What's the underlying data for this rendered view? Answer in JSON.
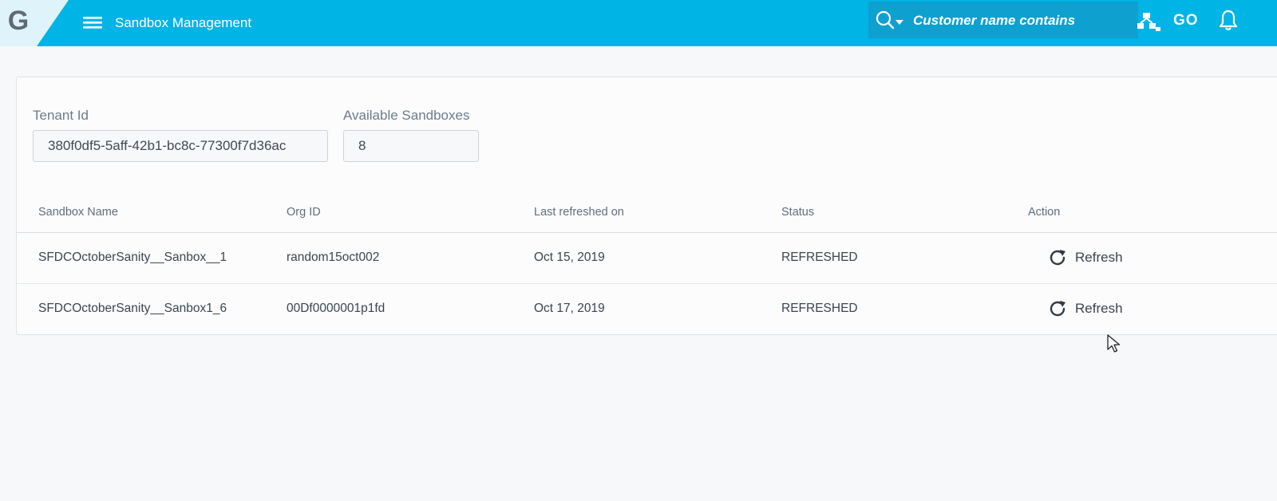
{
  "header": {
    "logo_letter": "G",
    "app_title": "Sandbox Management",
    "search_placeholder": "Customer name contains",
    "go_label": "GO"
  },
  "tenant": {
    "tenant_id_label": "Tenant Id",
    "tenant_id_value": "380f0df5-5aff-42b1-bc8c-77300f7d36ac",
    "available_label": "Available Sandboxes",
    "available_value": "8"
  },
  "table": {
    "columns": [
      "Sandbox Name",
      "Org ID",
      "Last refreshed on",
      "Status",
      "Action"
    ],
    "rows": [
      {
        "sandbox_name": "SFDCOctoberSanity__Sanbox__1",
        "org_id": "random15oct002",
        "last_refreshed": "Oct 15, 2019",
        "status": "REFRESHED",
        "action": "Refresh"
      },
      {
        "sandbox_name": "SFDCOctoberSanity__Sanbox1_6",
        "org_id": "00Df0000001p1fd",
        "last_refreshed": "Oct 17, 2019",
        "status": "REFRESHED",
        "action": "Refresh"
      }
    ]
  },
  "icons": {
    "menu": "hamburger-menu-icon",
    "search": "search-icon",
    "hierarchy": "hierarchy-icon",
    "notifications": "bell-icon",
    "refresh": "refresh-icon"
  },
  "colors": {
    "topbar": "#00b4e6",
    "search_bg": "#0ea0cf",
    "background": "#f6f8f9"
  }
}
